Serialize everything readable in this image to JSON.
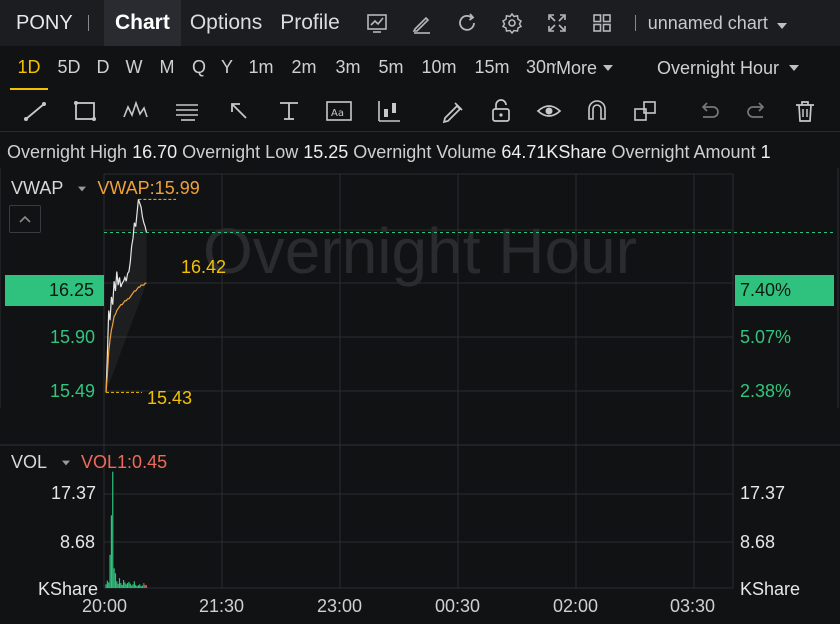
{
  "header": {
    "ticker": "PONY",
    "tabs": [
      {
        "label": "Chart",
        "active": true
      },
      {
        "label": "Options",
        "active": false
      },
      {
        "label": "Profile",
        "active": false
      }
    ],
    "icons": [
      "chart-type-icon",
      "draw-icon",
      "refresh-icon",
      "settings-icon",
      "fullscreen-icon",
      "layout-grid-icon"
    ],
    "chart_name": "unnamed chart"
  },
  "periods": {
    "items": [
      "1D",
      "5D",
      "D",
      "W",
      "M",
      "Q",
      "Y",
      "1m",
      "2m",
      "3m",
      "5m",
      "10m",
      "15m",
      "30m"
    ],
    "active": "1D",
    "more_label": "More",
    "session": "Overnight Hour"
  },
  "tools": [
    "line-tool-icon",
    "rectangle-tool-icon",
    "pattern-tool-icon",
    "fib-tool-icon",
    "arrow-tool-icon",
    "measure-tool-icon",
    "text-tool-icon",
    "candle-tool-icon",
    "pen-tool-icon",
    "lock-icon",
    "eye-icon",
    "magnet-icon",
    "layers-icon",
    "undo-icon",
    "redo-icon",
    "trash-icon"
  ],
  "info": {
    "high_label": "Overnight High",
    "high_value": "16.70",
    "low_label": "Overnight Low",
    "low_value": "15.25",
    "volume_label": "Overnight Volume",
    "volume_value": "64.71KShare",
    "amount_label": "Overnight Amount",
    "amount_value": "1"
  },
  "price_panel": {
    "indicator": "VWAP",
    "indicator_value": "VWAP:15.99",
    "watermark": "Overnight Hour",
    "current_price": "16.25",
    "current_pct": "7.40%",
    "left_ticks": [
      "15.90",
      "15.49"
    ],
    "right_ticks": [
      "5.07%",
      "2.38%"
    ],
    "high_annotation": "16.42",
    "low_annotation": "15.43"
  },
  "volume_panel": {
    "indicator": "VOL",
    "indicator_value": "VOL1:0.45",
    "left_ticks": [
      "17.37",
      "8.68",
      "KShare"
    ],
    "right_ticks": [
      "17.37",
      "8.68",
      "KShare"
    ]
  },
  "time_axis": [
    "20:00",
    "21:30",
    "23:00",
    "00:30",
    "02:00",
    "03:30"
  ],
  "chart_data": [
    {
      "type": "line",
      "x": [
        "20:00",
        "20:01",
        "20:02",
        "20:03",
        "20:04",
        "20:05",
        "20:06",
        "20:07",
        "20:08",
        "20:09",
        "20:10",
        "20:11",
        "20:12",
        "20:13",
        "20:14",
        "20:15",
        "20:16",
        "20:17",
        "20:18",
        "20:19",
        "20:20",
        "20:21",
        "20:22",
        "20:23",
        "20:24",
        "20:25",
        "20:26",
        "20:27",
        "20:28",
        "20:29",
        "20:30"
      ],
      "series": [
        {
          "values": [
            15.43,
            15.62,
            15.85,
            15.8,
            15.92,
            15.88,
            16.0,
            15.95,
            16.05,
            15.98,
            16.02,
            15.97,
            15.99,
            16.0,
            16.02,
            16.0,
            16.04,
            16.05,
            16.1,
            16.18,
            16.22,
            16.3,
            16.28,
            16.35,
            16.42,
            16.4,
            16.38,
            16.33,
            16.3,
            16.28,
            16.25
          ]
        },
        {
          "values": [
            15.43,
            15.52,
            15.64,
            15.7,
            15.75,
            15.78,
            15.82,
            15.83,
            15.85,
            15.86,
            15.87,
            15.88,
            15.88,
            15.89,
            15.9,
            15.9,
            15.91,
            15.91,
            15.92,
            15.93,
            15.94,
            15.95,
            15.95,
            15.96,
            15.97,
            15.97,
            15.98,
            15.98,
            15.98,
            15.99,
            15.99
          ]
        }
      ],
      "ylim": [
        15.35,
        16.55
      ]
    },
    {
      "type": "bar",
      "values": [
        0.6,
        1.2,
        0.9,
        5.4,
        11.8,
        18.9,
        3.2,
        2.4,
        1.1,
        0.7,
        1.6,
        0.8,
        0.5,
        1.3,
        0.9,
        0.6,
        0.8,
        1.0,
        0.7,
        0.4,
        0.6,
        1.1,
        0.5,
        0.3,
        0.45,
        0.6,
        0.3,
        0.4,
        0.8,
        0.5,
        0.45
      ],
      "colors": [
        "#2ec27e",
        "#2ec27e",
        "#2ec27e",
        "#2ec27e",
        "#2ec27e",
        "#2ec27e",
        "#2ec27e",
        "#2ec27e",
        "#2ec27e",
        "#2ec27e",
        "#2ec27e",
        "#2ec27e",
        "#2ec27e",
        "#2ec27e",
        "#2ec27e",
        "#2ec27e",
        "#2ec27e",
        "#2ec27e",
        "#2ec27e",
        "#2ec27e",
        "#2ec27e",
        "#2ec27e",
        "#2ec27e",
        "#2ec27e",
        "#2ec27e",
        "#2ec27e",
        "#2ec27e",
        "#2ec27e",
        "#e0464f",
        "#2ec27e",
        "#e0464f"
      ],
      "ylim": [
        0,
        19.5
      ]
    }
  ],
  "colors": {
    "accent": "#f2c200",
    "up": "#2ec27e",
    "down": "#e0464f",
    "vwap": "#f0a13a",
    "price_line": "#e6e6e6"
  }
}
